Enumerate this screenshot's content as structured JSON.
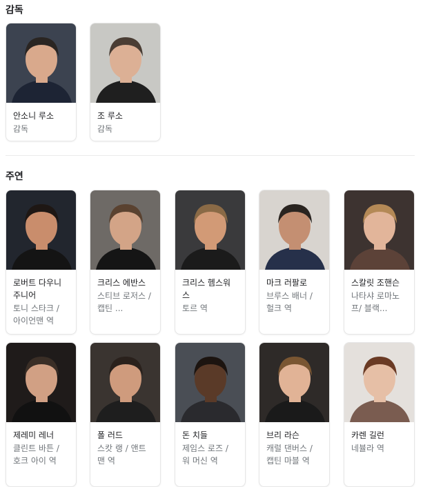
{
  "sections": {
    "directors_title": "감독",
    "cast_title": "주연"
  },
  "directors": [
    {
      "name": "안소니 루소",
      "role": "감독",
      "bg": "#3c4350",
      "skin": "#d9a98c",
      "hair": "#2a2522",
      "shirt": "#1d2434"
    },
    {
      "name": "조 루소",
      "role": "감독",
      "bg": "#c8c8c4",
      "skin": "#dcb095",
      "hair": "#4a3d34",
      "shirt": "#1f1f1f"
    }
  ],
  "cast": [
    {
      "name": "로버트 다우니 주니어",
      "role": "토니 스타크 / 아이언맨 역",
      "bg": "#22262e",
      "skin": "#c98d6c",
      "hair": "#1e1714",
      "shirt": "#141414"
    },
    {
      "name": "크리스 에반스",
      "role": "스티브 로저스 / 캡틴 ...",
      "bg": "#6e6a66",
      "skin": "#d3a487",
      "hair": "#5a4230",
      "shirt": "#151515"
    },
    {
      "name": "크리스 헴스워스",
      "role": "토르 역",
      "bg": "#3a3a3c",
      "skin": "#d29a76",
      "hair": "#8a6a46",
      "shirt": "#1b1b1b"
    },
    {
      "name": "마크 러팔로",
      "role": "브루스 배너 / 헐크 역",
      "bg": "#d8d4cf",
      "skin": "#c48f72",
      "hair": "#2a2420",
      "shirt": "#26304a"
    },
    {
      "name": "스칼릿 조핸슨",
      "role": "나타샤 로마노프/ 블랙...",
      "bg": "#3d3330",
      "skin": "#e2b59a",
      "hair": "#b48956",
      "shirt": "#5c4238"
    },
    {
      "name": "제레미 레너",
      "role": "클린트 바튼 / 호크 아이 역",
      "bg": "#1f1b1a",
      "skin": "#d1a084",
      "hair": "#3a2e26",
      "shirt": "#111111"
    },
    {
      "name": "폴 러드",
      "role": "스캇 랭 / 앤트맨 역",
      "bg": "#3a3430",
      "skin": "#cf9b7d",
      "hair": "#2a211c",
      "shirt": "#1e1e1e"
    },
    {
      "name": "돈 치들",
      "role": "제임스 로즈 / 워 머신 역",
      "bg": "#4a4e55",
      "skin": "#5a3a28",
      "hair": "#1c1410",
      "shirt": "#2a2a2e"
    },
    {
      "name": "브리 라슨",
      "role": "캐럴 댄버스 / 캡틴 마블 역",
      "bg": "#2e2a28",
      "skin": "#e1b396",
      "hair": "#7a5632",
      "shirt": "#1a1a1a"
    },
    {
      "name": "카렌 길런",
      "role": "네뷸라 역",
      "bg": "#e4e0dc",
      "skin": "#e6bfa6",
      "hair": "#6a3a24",
      "shirt": "#7a5c50"
    }
  ]
}
